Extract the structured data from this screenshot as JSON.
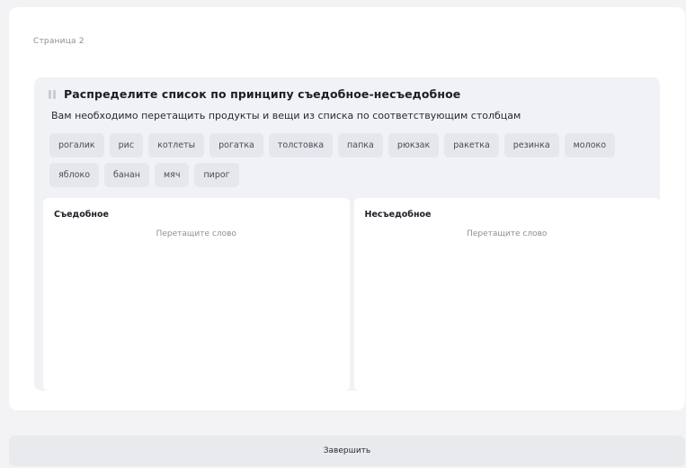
{
  "page": {
    "label": "Страница 2"
  },
  "task": {
    "title": "Распределите список по принципу съедобное-несъедобное",
    "description": "Вам необходимо перетащить продукты и вещи из списка по соответствующим столбцам",
    "items": [
      "рогалик",
      "рис",
      "котлеты",
      "рогатка",
      "толстовка",
      "папка",
      "рюкзак",
      "ракетка",
      "резинка",
      "молоко",
      "яблоко",
      "банан",
      "мяч",
      "пирог"
    ],
    "columns": [
      {
        "title": "Съедобное",
        "placeholder": "Перетащите слово"
      },
      {
        "title": "Несъедобное",
        "placeholder": "Перетащите слово"
      }
    ]
  },
  "footer": {
    "finish_label": "Завершить"
  },
  "icons": {
    "drag": "drag-handle-icon"
  }
}
